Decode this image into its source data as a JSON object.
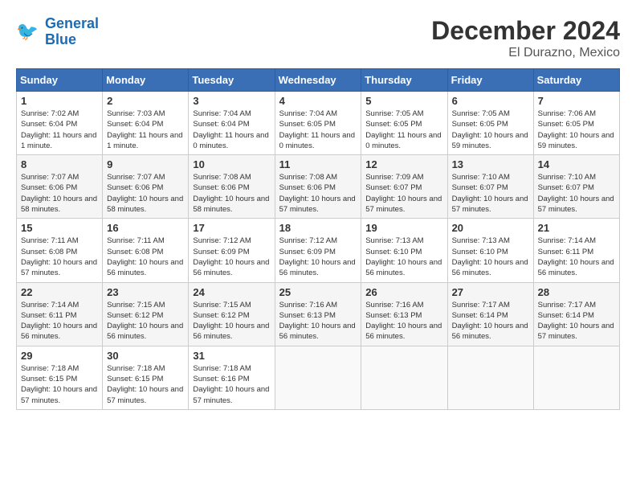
{
  "header": {
    "logo_line1": "General",
    "logo_line2": "Blue",
    "title": "December 2024",
    "subtitle": "El Durazno, Mexico"
  },
  "calendar": {
    "days_of_week": [
      "Sunday",
      "Monday",
      "Tuesday",
      "Wednesday",
      "Thursday",
      "Friday",
      "Saturday"
    ],
    "weeks": [
      [
        {
          "day": "",
          "info": ""
        },
        {
          "day": "2",
          "info": "Sunrise: 7:03 AM\nSunset: 6:04 PM\nDaylight: 11 hours and 1 minute."
        },
        {
          "day": "3",
          "info": "Sunrise: 7:04 AM\nSunset: 6:04 PM\nDaylight: 11 hours and 0 minutes."
        },
        {
          "day": "4",
          "info": "Sunrise: 7:04 AM\nSunset: 6:05 PM\nDaylight: 11 hours and 0 minutes."
        },
        {
          "day": "5",
          "info": "Sunrise: 7:05 AM\nSunset: 6:05 PM\nDaylight: 11 hours and 0 minutes."
        },
        {
          "day": "6",
          "info": "Sunrise: 7:05 AM\nSunset: 6:05 PM\nDaylight: 10 hours and 59 minutes."
        },
        {
          "day": "7",
          "info": "Sunrise: 7:06 AM\nSunset: 6:05 PM\nDaylight: 10 hours and 59 minutes."
        }
      ],
      [
        {
          "day": "1",
          "info": "Sunrise: 7:02 AM\nSunset: 6:04 PM\nDaylight: 11 hours and 1 minute.",
          "first": true
        },
        {
          "day": "8",
          "info": "Sunrise: 7:07 AM\nSunset: 6:06 PM\nDaylight: 10 hours and 58 minutes."
        },
        {
          "day": "9",
          "info": "Sunrise: 7:07 AM\nSunset: 6:06 PM\nDaylight: 10 hours and 58 minutes."
        },
        {
          "day": "10",
          "info": "Sunrise: 7:08 AM\nSunset: 6:06 PM\nDaylight: 10 hours and 58 minutes."
        },
        {
          "day": "11",
          "info": "Sunrise: 7:08 AM\nSunset: 6:06 PM\nDaylight: 10 hours and 57 minutes."
        },
        {
          "day": "12",
          "info": "Sunrise: 7:09 AM\nSunset: 6:07 PM\nDaylight: 10 hours and 57 minutes."
        },
        {
          "day": "13",
          "info": "Sunrise: 7:10 AM\nSunset: 6:07 PM\nDaylight: 10 hours and 57 minutes."
        },
        {
          "day": "14",
          "info": "Sunrise: 7:10 AM\nSunset: 6:07 PM\nDaylight: 10 hours and 57 minutes."
        }
      ],
      [
        {
          "day": "15",
          "info": "Sunrise: 7:11 AM\nSunset: 6:08 PM\nDaylight: 10 hours and 57 minutes."
        },
        {
          "day": "16",
          "info": "Sunrise: 7:11 AM\nSunset: 6:08 PM\nDaylight: 10 hours and 56 minutes."
        },
        {
          "day": "17",
          "info": "Sunrise: 7:12 AM\nSunset: 6:09 PM\nDaylight: 10 hours and 56 minutes."
        },
        {
          "day": "18",
          "info": "Sunrise: 7:12 AM\nSunset: 6:09 PM\nDaylight: 10 hours and 56 minutes."
        },
        {
          "day": "19",
          "info": "Sunrise: 7:13 AM\nSunset: 6:10 PM\nDaylight: 10 hours and 56 minutes."
        },
        {
          "day": "20",
          "info": "Sunrise: 7:13 AM\nSunset: 6:10 PM\nDaylight: 10 hours and 56 minutes."
        },
        {
          "day": "21",
          "info": "Sunrise: 7:14 AM\nSunset: 6:11 PM\nDaylight: 10 hours and 56 minutes."
        }
      ],
      [
        {
          "day": "22",
          "info": "Sunrise: 7:14 AM\nSunset: 6:11 PM\nDaylight: 10 hours and 56 minutes."
        },
        {
          "day": "23",
          "info": "Sunrise: 7:15 AM\nSunset: 6:12 PM\nDaylight: 10 hours and 56 minutes."
        },
        {
          "day": "24",
          "info": "Sunrise: 7:15 AM\nSunset: 6:12 PM\nDaylight: 10 hours and 56 minutes."
        },
        {
          "day": "25",
          "info": "Sunrise: 7:16 AM\nSunset: 6:13 PM\nDaylight: 10 hours and 56 minutes."
        },
        {
          "day": "26",
          "info": "Sunrise: 7:16 AM\nSunset: 6:13 PM\nDaylight: 10 hours and 56 minutes."
        },
        {
          "day": "27",
          "info": "Sunrise: 7:17 AM\nSunset: 6:14 PM\nDaylight: 10 hours and 56 minutes."
        },
        {
          "day": "28",
          "info": "Sunrise: 7:17 AM\nSunset: 6:14 PM\nDaylight: 10 hours and 57 minutes."
        }
      ],
      [
        {
          "day": "29",
          "info": "Sunrise: 7:18 AM\nSunset: 6:15 PM\nDaylight: 10 hours and 57 minutes."
        },
        {
          "day": "30",
          "info": "Sunrise: 7:18 AM\nSunset: 6:15 PM\nDaylight: 10 hours and 57 minutes."
        },
        {
          "day": "31",
          "info": "Sunrise: 7:18 AM\nSunset: 6:16 PM\nDaylight: 10 hours and 57 minutes."
        },
        {
          "day": "",
          "info": ""
        },
        {
          "day": "",
          "info": ""
        },
        {
          "day": "",
          "info": ""
        },
        {
          "day": "",
          "info": ""
        }
      ]
    ]
  }
}
